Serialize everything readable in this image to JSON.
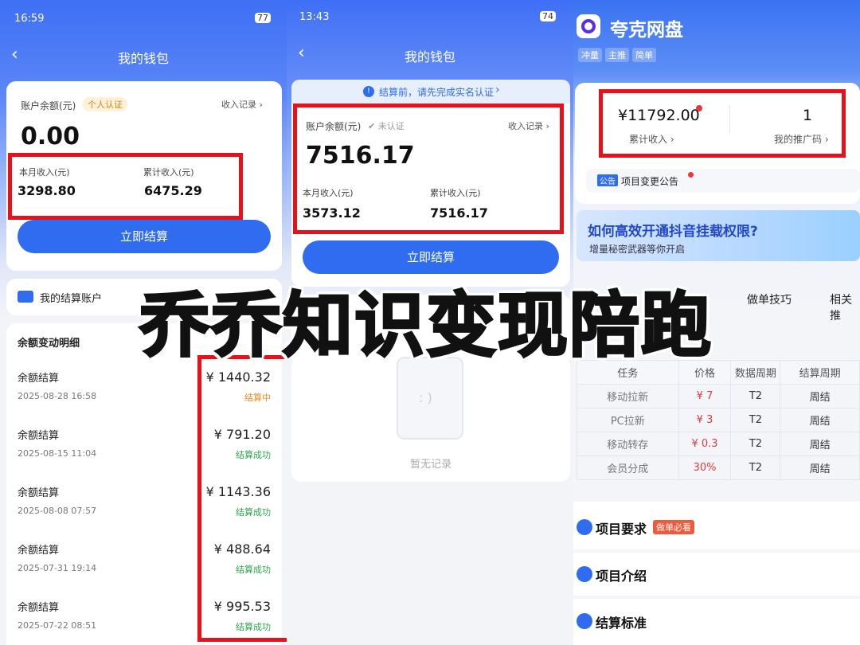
{
  "panel1": {
    "status_time": "16:59",
    "status_battery": "77",
    "nav_title": "我的钱包",
    "balance_label": "账户余额(元)",
    "verify_badge": "个人认证",
    "income_record": "收入记录",
    "balance": "0.00",
    "month_income_label": "本月收入(元)",
    "month_income": "3298.80",
    "total_income_label": "累计收入(元)",
    "total_income": "6475.29",
    "settle_btn": "立即结算",
    "account_label": "我的结算账户",
    "detail_title": "余额变动明细",
    "transactions": [
      {
        "title": "余额结算",
        "date": "2025-08-28 16:58",
        "amount": "¥ 1440.32",
        "status": "结算中"
      },
      {
        "title": "余额结算",
        "date": "2025-08-15 11:04",
        "amount": "¥ 791.20",
        "status": "结算成功"
      },
      {
        "title": "余额结算",
        "date": "2025-08-08 07:57",
        "amount": "¥ 1143.36",
        "status": "结算成功"
      },
      {
        "title": "余额结算",
        "date": "2025-07-31 19:14",
        "amount": "¥ 488.64",
        "status": "结算成功"
      },
      {
        "title": "余额结算",
        "date": "2025-07-22 08:51",
        "amount": "¥ 995.53",
        "status": "结算成功"
      }
    ]
  },
  "panel2": {
    "status_time": "13:43",
    "status_battery": "74",
    "nav_title": "我的钱包",
    "notice": "结算前，请先完成实名认证",
    "balance_label": "账户余额(元)",
    "verify_badge": "未认证",
    "income_record": "收入记录",
    "balance": "7516.17",
    "month_income_label": "本月收入(元)",
    "month_income": "3573.12",
    "total_income_label": "累计收入(元)",
    "total_income": "7516.17",
    "settle_btn": "立即结算",
    "empty_text": "暂无记录"
  },
  "panel3": {
    "app_title": "夸克网盘",
    "tags": [
      "冲量",
      "主推",
      "简单"
    ],
    "total_income": "¥11792.00",
    "total_income_label": "累计收入",
    "promo_count": "1",
    "promo_label": "我的推广码",
    "announce_badge": "公告",
    "announce_text": "项目变更公告",
    "banner_title": "如何高效开通抖音挂载权限?",
    "banner_sub": "增量秘密武器等你开启",
    "tabs": [
      "做单技巧",
      "相关推"
    ],
    "table_headers": [
      "任务",
      "价格",
      "数据周期",
      "结算周期"
    ],
    "table_rows": [
      [
        "移动拉新",
        "¥ 7",
        "T2",
        "周结"
      ],
      [
        "PC拉新",
        "¥ 3",
        "T2",
        "周结"
      ],
      [
        "移动转存",
        "¥ 0.3",
        "T2",
        "周结"
      ],
      [
        "会员分成",
        "30%",
        "T2",
        "周结"
      ]
    ],
    "section_requirements": "项目要求",
    "requirements_badge": "做单必看",
    "section_intro": "项目介绍",
    "section_standard": "结算标准"
  },
  "overlay_text": "乔乔知识变现陪跑",
  "colors": {
    "accent": "#2f6cf0",
    "red": "#e8101a",
    "success": "#2aa84a",
    "pending": "#f08a1c"
  }
}
